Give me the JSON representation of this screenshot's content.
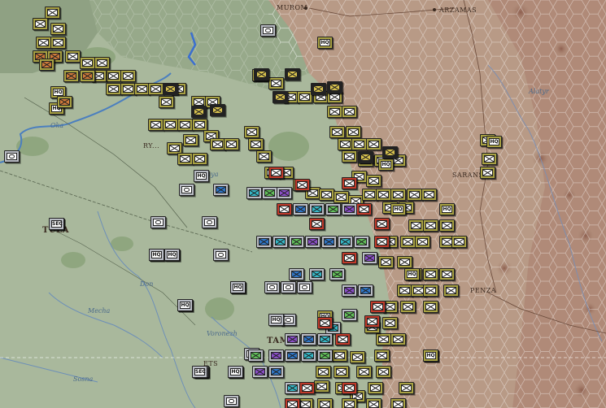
{
  "map": {
    "cities": [
      {
        "id": "murom",
        "label": "MUROM"
      },
      {
        "id": "arzamas",
        "label": "ARZAMAS"
      },
      {
        "id": "saransk",
        "label": "SARANSK"
      },
      {
        "id": "penza",
        "label": "PENZA"
      },
      {
        "id": "tula",
        "label": "TULA"
      },
      {
        "id": "ryazan",
        "label": "RY..."
      },
      {
        "id": "tambov",
        "label": "TAM..."
      },
      {
        "id": "yelets",
        "label": "ETS"
      }
    ],
    "rivers": [
      {
        "id": "oka",
        "label": "Oka"
      },
      {
        "id": "alatyr",
        "label": "Alatyr"
      },
      {
        "id": "voronezh",
        "label": "Voronezh"
      },
      {
        "id": "mecha",
        "label": "Mecha"
      },
      {
        "id": "don",
        "label": "Don"
      },
      {
        "id": "sosna",
        "label": "Sosna"
      },
      {
        "id": "pronya",
        "label": "Pronya"
      }
    ],
    "unit_labels": {
      "hq": "HQ",
      "sec": "SEC"
    },
    "colors": {
      "axis_counter": "#a8a142",
      "soviet_counter": "#b9bcc4",
      "attacking_counter": "#c03a2a",
      "terrain_hills": "#b59883",
      "terrain_plain": "#a9b89c",
      "river": "#4b7fbf"
    }
  }
}
